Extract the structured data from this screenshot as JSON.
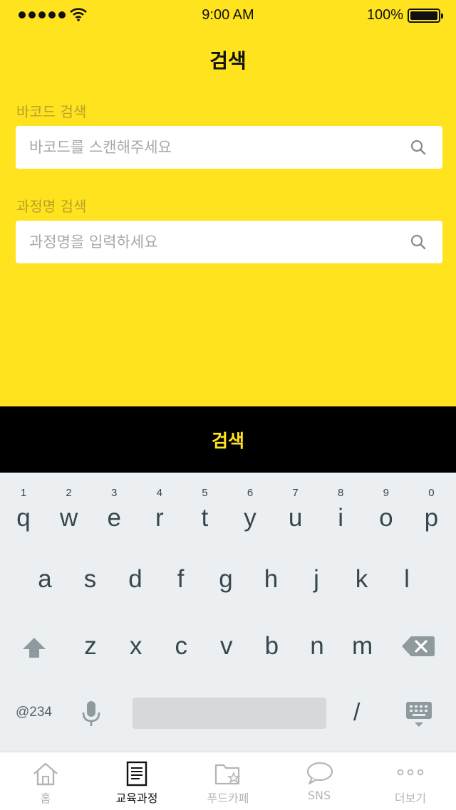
{
  "status_bar": {
    "time": "9:00 AM",
    "battery": "100%"
  },
  "header": {
    "title": "검색"
  },
  "barcode_search": {
    "label": "바코드 검색",
    "placeholder": "바코드를 스캔해주세요"
  },
  "course_search": {
    "label": "과정명 검색",
    "placeholder": "과정명을 입력하세요"
  },
  "search_button": {
    "label": "검색"
  },
  "keyboard": {
    "row1": [
      {
        "ch": "q",
        "hint": "1"
      },
      {
        "ch": "w",
        "hint": "2"
      },
      {
        "ch": "e",
        "hint": "3"
      },
      {
        "ch": "r",
        "hint": "4"
      },
      {
        "ch": "t",
        "hint": "5"
      },
      {
        "ch": "y",
        "hint": "6"
      },
      {
        "ch": "u",
        "hint": "7"
      },
      {
        "ch": "i",
        "hint": "8"
      },
      {
        "ch": "o",
        "hint": "9"
      },
      {
        "ch": "p",
        "hint": "0"
      }
    ],
    "row2": [
      "a",
      "s",
      "d",
      "f",
      "g",
      "h",
      "j",
      "k",
      "l"
    ],
    "row3": [
      "z",
      "x",
      "c",
      "v",
      "b",
      "n",
      "m"
    ],
    "symbols_label": "@234",
    "slash": "/"
  },
  "tab_bar": {
    "items": [
      {
        "label": "홈",
        "icon": "home-icon",
        "active": false
      },
      {
        "label": "교육과정",
        "icon": "document-icon",
        "active": true
      },
      {
        "label": "푸드카페",
        "icon": "folder-star-icon",
        "active": false
      },
      {
        "label": "SNS",
        "icon": "chat-bubble-icon",
        "active": false
      },
      {
        "label": "더보기",
        "icon": "more-icon",
        "active": false
      }
    ]
  },
  "colors": {
    "brand_yellow": "#ffe31e",
    "button_black": "#000000",
    "label_gold": "#b8a02a",
    "keyboard_bg": "#eceff1"
  }
}
